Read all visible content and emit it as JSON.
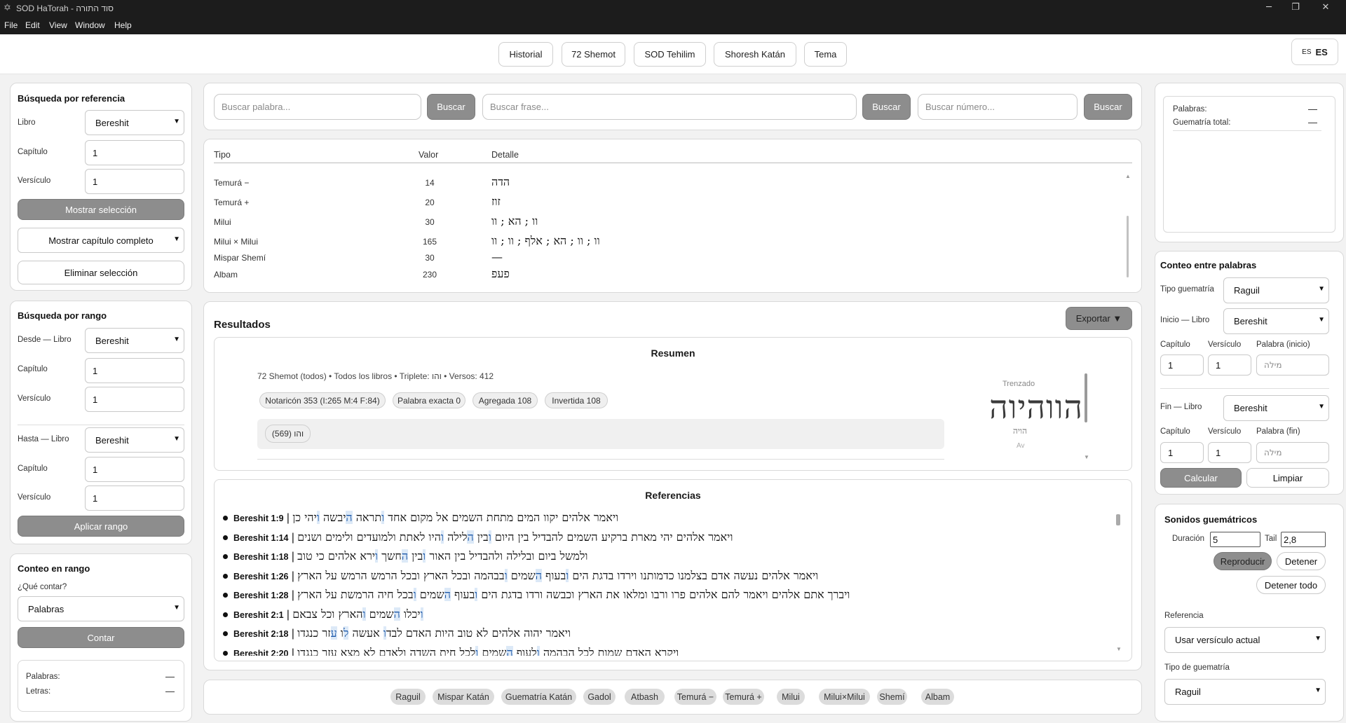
{
  "window": {
    "title": "SOD HaTorah - סוד התורה"
  },
  "menu": [
    "File",
    "Edit",
    "View",
    "Window",
    "Help"
  ],
  "nav": {
    "buttons": [
      "Historial",
      "72 Shemot",
      "SOD Tehilim",
      "Shoresh Katán",
      "Tema"
    ],
    "lang_small": "ES",
    "lang_big": "ES"
  },
  "ref_search": {
    "title": "Búsqueda por referencia",
    "libro_label": "Libro",
    "libro_value": "Bereshit",
    "capitulo_label": "Capítulo",
    "capitulo_value": "1",
    "versiculo_label": "Versículo",
    "versiculo_value": "1",
    "show_btn": "Mostrar selección",
    "mode_select": "Mostrar capítulo completo",
    "clear_btn": "Eliminar selección"
  },
  "range_search": {
    "title": "Búsqueda por rango",
    "desde_label": "Desde — Libro",
    "desde_value": "Bereshit",
    "cap_label": "Capítulo",
    "cap_value": "1",
    "vers_label": "Versículo",
    "vers_value": "1",
    "hasta_label": "Hasta — Libro",
    "hasta_value": "Bereshit",
    "cap2_label": "Capítulo",
    "cap2_value": "1",
    "vers2_label": "Versículo",
    "vers2_value": "1",
    "apply_btn": "Aplicar rango"
  },
  "range_count": {
    "title": "Conteo en rango",
    "question": "¿Qué contar?",
    "select_value": "Palabras",
    "btn": "Contar",
    "palabras_label": "Palabras:",
    "palabras_value": "—",
    "letras_label": "Letras:",
    "letras_value": "—"
  },
  "search": {
    "word_placeholder": "Buscar palabra...",
    "phrase_placeholder": "Buscar frase...",
    "number_placeholder": "Buscar número...",
    "btn": "Buscar"
  },
  "gematria_table": {
    "headers": [
      "Tipo",
      "Valor",
      "Detalle"
    ],
    "rows": [
      {
        "tipo": "Temurá −",
        "valor": "14",
        "detalle": "הדה"
      },
      {
        "tipo": "Temurá +",
        "valor": "20",
        "detalle": "זוז"
      },
      {
        "tipo": "Milui",
        "valor": "30",
        "detalle": "וו ; הא ; וו"
      },
      {
        "tipo": "Milui × Milui",
        "valor": "165",
        "detalle": "וו ; וו ; הא ; אלף ; וו ; וו"
      },
      {
        "tipo": "Mispar Shemí",
        "valor": "30",
        "detalle": "—"
      },
      {
        "tipo": "Albam",
        "valor": "230",
        "detalle": "פעפ"
      }
    ]
  },
  "results": {
    "title": "Resultados",
    "export_btn": "Exportar ▼"
  },
  "summary": {
    "title": "Resumen",
    "info": "72 Shemot (todos) • Todos los libros • Triplete: והו • Versos: 412",
    "chips": [
      "Notaricón 353 (I:265 M:4 F:84)",
      "Palabra exacta 0",
      "Agregada 108",
      "Invertida 108"
    ],
    "result_chip": "והו (569)",
    "trenzado_label": "Trenzado",
    "trenzado_word": "הווהיוה",
    "trenzado_sub": "הויה",
    "trenzado_sub2": "Av"
  },
  "references": {
    "title": "Referencias",
    "items": [
      {
        "ref": "Bereshit 1:9",
        "pre": "ויאמר אלהים יקוו המים מתחת השמים אל מקום אחד ",
        "h1": "ו",
        "mid": "תראה ",
        "h2": "ה",
        "post": "יבשה ",
        "h3": "ו",
        "end": "יהי כן"
      },
      {
        "ref": "Bereshit 1:14",
        "pre": "ויאמר אלהים יהי מארת ברקיע השמים להבדיל בין היום ",
        "h1": "ו",
        "mid": "בין ",
        "h2": "ה",
        "post": "לילה ",
        "h3": "ו",
        "end": "היו לאתת ולמועדים ולימים ושנים"
      },
      {
        "ref": "Bereshit 1:18",
        "pre": "ולמשל ביום ובלילה ולהבדיל בין האור ",
        "h1": "ו",
        "mid": "בין ",
        "h2": "ה",
        "post": "חשך ",
        "h3": "ו",
        "end": "ירא אלהים כי טוב"
      },
      {
        "ref": "Bereshit 1:26",
        "pre": "ויאמר אלהים נעשה אדם בצלמנו כדמותנו וירדו בדגת הים ",
        "h1": "ו",
        "mid": "בעוף ",
        "h2": "ה",
        "post": "שמים ",
        "h3": "ו",
        "end": "בבהמה ובכל הארץ ובכל הרמש הרמש על הארץ"
      },
      {
        "ref": "Bereshit 1:28",
        "pre": "ויברך אתם אלהים ויאמר להם אלהים פרו ורבו ומלאו את הארץ וכבשה ורדו בדגת הים ",
        "h1": "ו",
        "mid": "בעוף ",
        "h2": "ה",
        "post": "שמים ",
        "h3": "ו",
        "end": "בכל חיה הרמשת על הארץ"
      },
      {
        "ref": "Bereshit 2:1",
        "pre": "",
        "h1": "ו",
        "mid": "יכלו ",
        "h2": "ה",
        "post": "שמים ",
        "h3": "ו",
        "end": "הארץ וכל צבאם"
      },
      {
        "ref": "Bereshit 2:18",
        "pre": "ויאמר יהוה אלהים לא טוב היות האדם לבד",
        "h1": "ו",
        "mid": " אעשה ",
        "h2": "ל",
        "post": "ו ",
        "h3": "ע",
        "end": "זר כנגדו"
      },
      {
        "ref": "Bereshit 2:20",
        "pre": "ויקרא האדם שמות לכל הבהמה ",
        "h1": "ו",
        "mid": "לעוף ",
        "h2": "ה",
        "post": "שמים ",
        "h3": "ו",
        "end": "לכל חית השדה ולאדם לא מצא עזר כנגדו"
      }
    ]
  },
  "bottom_chips": [
    "Raguil",
    "Mispar Katán",
    "Guematría Katán",
    "Gadol",
    "Atbash",
    "Temurá −",
    "Temurá +",
    "Milui",
    "Milui×Milui",
    "Shemí",
    "Albam"
  ],
  "right_stats": {
    "palabras_label": "Palabras:",
    "palabras_value": "—",
    "guematria_label": "Guematría total:",
    "guematria_value": "—"
  },
  "conteo": {
    "title": "Conteo entre palabras",
    "tipo_label": "Tipo guematría",
    "tipo_value": "Raguil",
    "inicio_label": "Inicio — Libro",
    "inicio_value": "Bereshit",
    "cap_label": "Capítulo",
    "vers_label": "Versículo",
    "palabra_inicio_label": "Palabra (inicio)",
    "cap_value": "1",
    "vers_value": "1",
    "palabra_placeholder": "מילה",
    "fin_label": "Fin — Libro",
    "fin_value": "Bereshit",
    "cap2_label": "Capítulo",
    "vers2_label": "Versículo",
    "palabra_fin_label": "Palabra (fin)",
    "cap2_value": "1",
    "vers2_value": "1",
    "calc_btn": "Calcular",
    "clear_btn": "Limpiar"
  },
  "sounds": {
    "title": "Sonidos guemátricos",
    "duracion_label": "Duración",
    "duracion_value": "5",
    "tail_label": "Tail",
    "tail_value": "2,8",
    "play_btn": "Reproducir",
    "stop_btn": "Detener",
    "stop_all_btn": "Detener todo",
    "ref_label": "Referencia",
    "ref_value": "Usar versículo actual",
    "tipo_label": "Tipo de guematría",
    "tipo_value": "Raguil"
  }
}
